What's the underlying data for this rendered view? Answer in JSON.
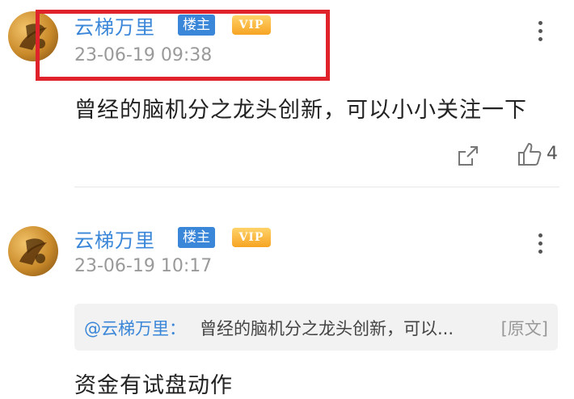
{
  "posts": [
    {
      "username": "云梯万里",
      "owner_badge": "楼主",
      "vip_badge": "VIP",
      "timestamp": "23-06-19 09:38",
      "content": "曾经的脑机分之龙头创新，可以小小关注一下",
      "actions": {
        "share_icon": "share-icon",
        "like_icon": "thumbs-up-icon",
        "like_count": "4"
      },
      "more_icon": "more-vertical-icon",
      "highlight_color": "#e0232a"
    },
    {
      "username": "云梯万里",
      "owner_badge": "楼主",
      "vip_badge": "VIP",
      "timestamp": "23-06-19 10:17",
      "quote": {
        "mention": "@云梯万里：",
        "text": "曾经的脑机分之龙头创新，可以...",
        "original_link": "[原文]"
      },
      "content": "资金有试盘动作",
      "more_icon": "more-vertical-icon"
    }
  ],
  "colors": {
    "username_blue": "#3a86d8",
    "vip_gold": "#f6a423",
    "timestamp_gray": "#9a9a9a"
  }
}
